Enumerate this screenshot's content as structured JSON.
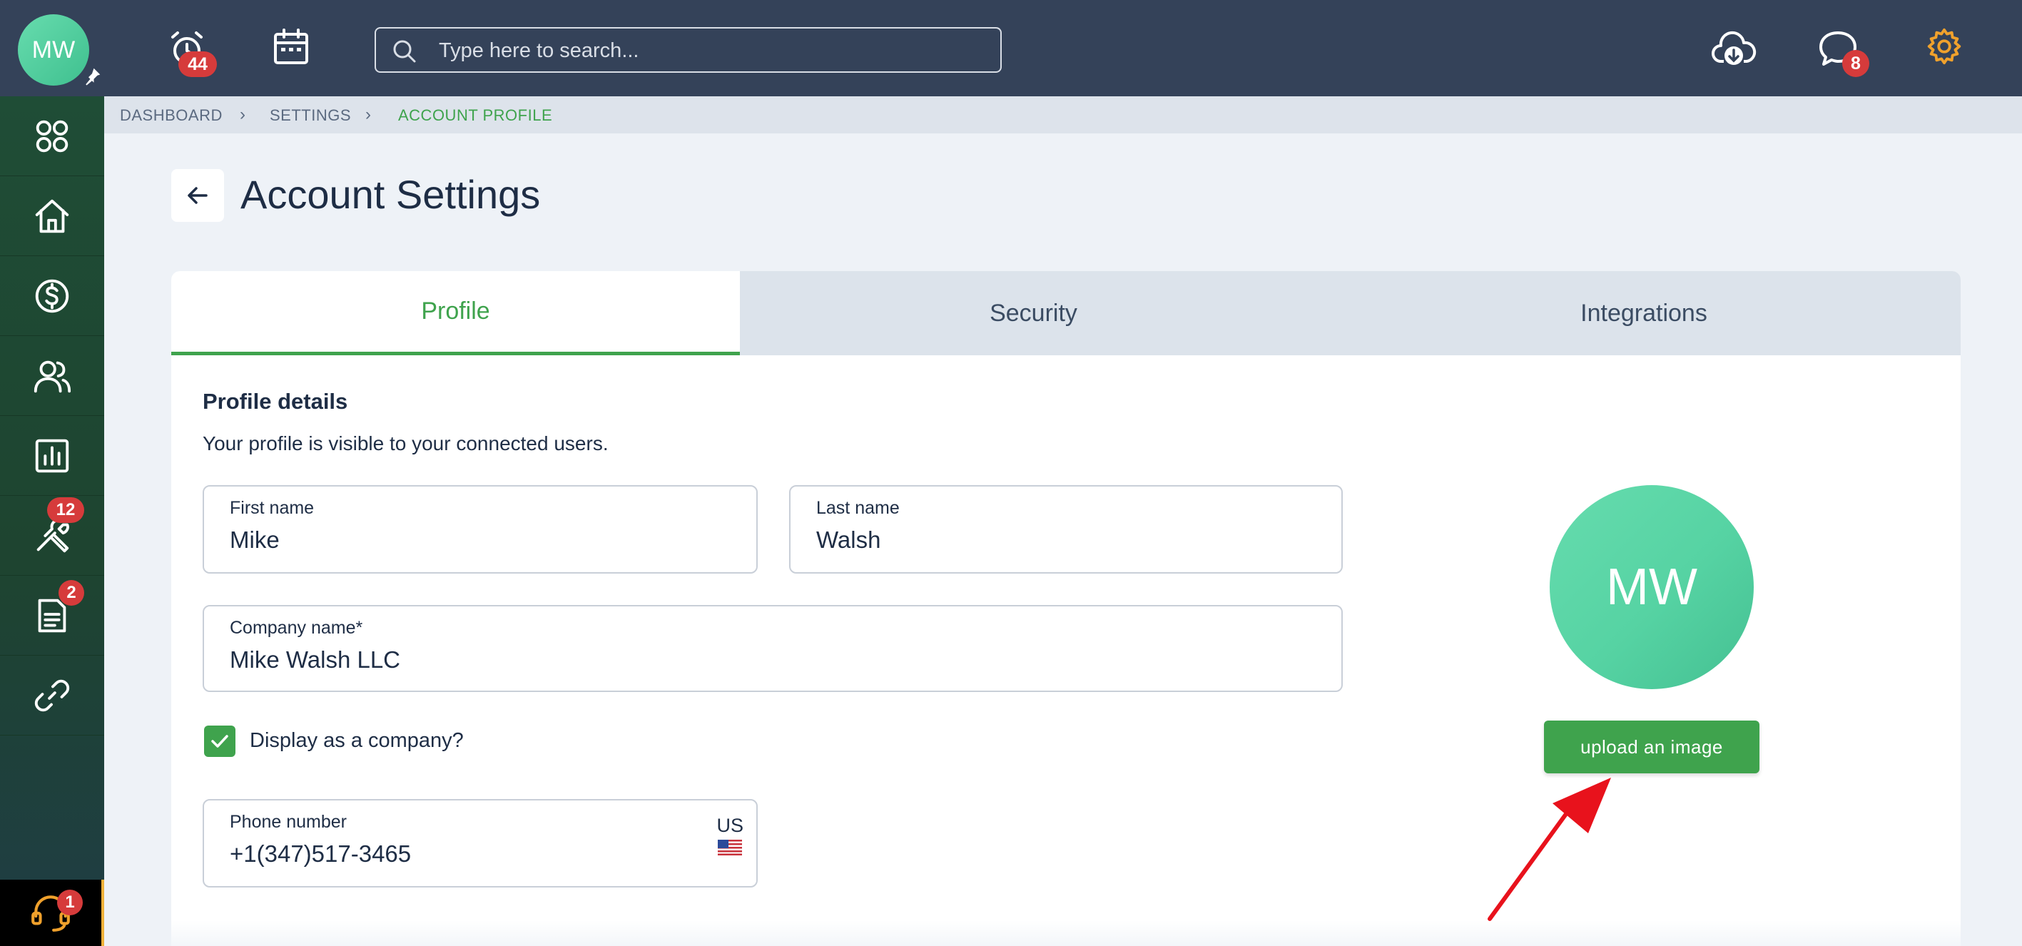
{
  "topbar": {
    "user_initials": "MW",
    "alerts_count": "44",
    "search_placeholder": "Type here to search...",
    "messages_count": "8"
  },
  "sidebar": {
    "items": [
      {
        "name": "apps",
        "icon": "apps-grid-icon",
        "badge": ""
      },
      {
        "name": "home",
        "icon": "home-icon",
        "badge": ""
      },
      {
        "name": "billing",
        "icon": "dollar-icon",
        "badge": ""
      },
      {
        "name": "contacts",
        "icon": "users-icon",
        "badge": ""
      },
      {
        "name": "reports",
        "icon": "bar-chart-icon",
        "badge": ""
      },
      {
        "name": "tools",
        "icon": "tools-icon",
        "badge": "12"
      },
      {
        "name": "documents",
        "icon": "document-icon",
        "badge": "2"
      },
      {
        "name": "links",
        "icon": "link-icon",
        "badge": ""
      }
    ],
    "support_badge": "1"
  },
  "breadcrumb": {
    "items": [
      "DASHBOARD",
      "SETTINGS",
      "ACCOUNT PROFILE"
    ]
  },
  "page": {
    "title": "Account Settings"
  },
  "tabs": [
    {
      "label": "Profile",
      "active": true
    },
    {
      "label": "Security",
      "active": false
    },
    {
      "label": "Integrations",
      "active": false
    }
  ],
  "profile": {
    "section_title": "Profile details",
    "section_subtitle": "Your profile is visible to your connected users.",
    "first_name_label": "First name",
    "first_name_value": "Mike",
    "last_name_label": "Last name",
    "last_name_value": "Walsh",
    "company_label": "Company name*",
    "company_value": "Mike Walsh LLC",
    "display_company_label": "Display as a company?",
    "display_company_checked": true,
    "phone_label": "Phone number",
    "phone_value": "+1(347)517-3465",
    "phone_country": "US",
    "avatar_initials": "MW",
    "upload_label": "upload an image"
  },
  "colors": {
    "topbar": "#344259",
    "accent_green": "#3fa34d",
    "badge_red": "#d63b3b",
    "gear_orange": "#f0a12c",
    "annotation_arrow": "#e8121c"
  }
}
